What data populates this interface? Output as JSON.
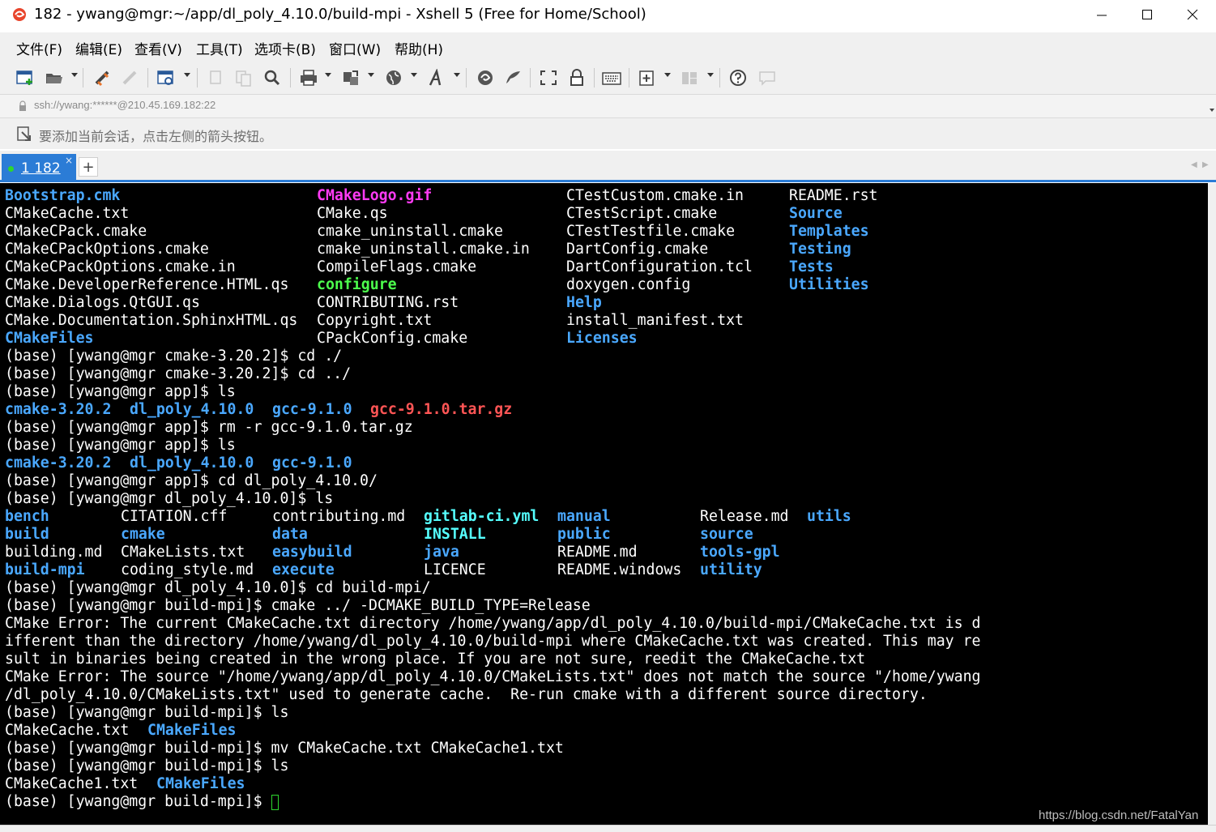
{
  "window": {
    "title": "182 - ywang@mgr:~/app/dl_poly_4.10.0/build-mpi - Xshell 5 (Free for Home/School)"
  },
  "menu": [
    "文件(F)",
    "编辑(E)",
    "查看(V)",
    "工具(T)",
    "选项卡(B)",
    "窗口(W)",
    "帮助(H)"
  ],
  "toolbar": {
    "icons": [
      "new-session-icon",
      "open-folder-icon",
      "reconnect-icon",
      "disconnect-icon",
      "properties-icon",
      "copy-icon",
      "paste-icon",
      "find-icon",
      "print-icon",
      "transfer-icon",
      "globe-icon",
      "font-icon",
      "xftp-icon",
      "xmanager-icon",
      "fullscreen-icon",
      "lock-icon",
      "keyboard-icon",
      "add-icon",
      "layout-icon",
      "help-icon",
      "chat-icon"
    ]
  },
  "address": {
    "text": "ssh://ywang:******@210.45.169.182:22"
  },
  "infobar": {
    "text": "要添加当前会话，点击左侧的箭头按钮。"
  },
  "tabs": [
    {
      "label": "1 182",
      "close": "×"
    }
  ],
  "tab_add": "+",
  "terminal": {
    "colors": {
      "dir": "#4aa8ff",
      "image": "#ff3bf5",
      "executable": "#4dff4d",
      "archive": "#ff5555",
      "link": "#55ffff",
      "cursor": "#2ed62e"
    },
    "lines": [
      [
        {
          "t": "Bootstrap.cmk",
          "s": "dir"
        },
        {
          "t": "CMakeLogo.gif",
          "s": "mag"
        },
        {
          "t": "CTestCustom.cmake.in",
          "s": "white"
        },
        {
          "t": "README.rst",
          "s": "white"
        }
      ],
      [
        {
          "t": "CMakeCache.txt",
          "s": "white"
        },
        {
          "t": "CMake.qs",
          "s": "white"
        },
        {
          "t": "CTestScript.cmake",
          "s": "white"
        },
        {
          "t": "Source",
          "s": "dir"
        }
      ],
      [
        {
          "t": "CMakeCPack.cmake",
          "s": "white"
        },
        {
          "t": "cmake_uninstall.cmake",
          "s": "white"
        },
        {
          "t": "CTestTestfile.cmake",
          "s": "white"
        },
        {
          "t": "Templates",
          "s": "dir"
        }
      ],
      [
        {
          "t": "CMakeCPackOptions.cmake",
          "s": "white"
        },
        {
          "t": "cmake_uninstall.cmake.in",
          "s": "white"
        },
        {
          "t": "DartConfig.cmake",
          "s": "white"
        },
        {
          "t": "Testing",
          "s": "dir"
        }
      ],
      [
        {
          "t": "CMakeCPackOptions.cmake.in",
          "s": "white"
        },
        {
          "t": "CompileFlags.cmake",
          "s": "white"
        },
        {
          "t": "DartConfiguration.tcl",
          "s": "white"
        },
        {
          "t": "Tests",
          "s": "dir"
        }
      ],
      [
        {
          "t": "CMake.DeveloperReference.HTML.qs",
          "s": "white"
        },
        {
          "t": "configure",
          "s": "exe"
        },
        {
          "t": "doxygen.config",
          "s": "white"
        },
        {
          "t": "Utilities",
          "s": "dir"
        }
      ],
      [
        {
          "t": "CMake.Dialogs.QtGUI.qs",
          "s": "white"
        },
        {
          "t": "CONTRIBUTING.rst",
          "s": "white"
        },
        {
          "t": "Help",
          "s": "dir"
        }
      ],
      [
        {
          "t": "CMake.Documentation.SphinxHTML.qs",
          "s": "white"
        },
        {
          "t": "Copyright.txt",
          "s": "white"
        },
        {
          "t": "install_manifest.txt",
          "s": "white"
        }
      ],
      [
        {
          "t": "CMakeFiles",
          "s": "dir"
        },
        {
          "t": "CPackConfig.cmake",
          "s": "white"
        },
        {
          "t": "Licenses",
          "s": "dir"
        }
      ],
      [
        {
          "t": "(base) [ywang@mgr cmake-3.20.2]$ cd ./",
          "s": "white"
        }
      ],
      [
        {
          "t": "(base) [ywang@mgr cmake-3.20.2]$ cd ../",
          "s": "white"
        }
      ],
      [
        {
          "t": "(base) [ywang@mgr app]$ ls",
          "s": "white"
        }
      ],
      [
        {
          "t": "cmake-3.20.2",
          "s": "dir"
        },
        {
          "t": "dl_poly_4.10.0",
          "s": "dir"
        },
        {
          "t": "gcc-9.1.0",
          "s": "dir"
        },
        {
          "t": "gcc-9.1.0.tar.gz",
          "s": "red"
        }
      ],
      [
        {
          "t": "(base) [ywang@mgr app]$ rm -r gcc-9.1.0.tar.gz",
          "s": "white"
        }
      ],
      [
        {
          "t": "(base) [ywang@mgr app]$ ls",
          "s": "white"
        }
      ],
      [
        {
          "t": "cmake-3.20.2",
          "s": "dir"
        },
        {
          "t": "dl_poly_4.10.0",
          "s": "dir"
        },
        {
          "t": "gcc-9.1.0",
          "s": "dir"
        }
      ],
      [
        {
          "t": "(base) [ywang@mgr app]$ cd dl_poly_4.10.0/",
          "s": "white"
        }
      ],
      [
        {
          "t": "(base) [ywang@mgr dl_poly_4.10.0]$ ls",
          "s": "white"
        }
      ],
      [
        {
          "t": "bench",
          "s": "dir"
        },
        {
          "t": "CITATION.cff",
          "s": "white"
        },
        {
          "t": "contributing.md",
          "s": "white"
        },
        {
          "t": "gitlab-ci.yml",
          "s": "cyan"
        },
        {
          "t": "manual",
          "s": "dir"
        },
        {
          "t": "Release.md",
          "s": "white"
        },
        {
          "t": "utils",
          "s": "dir"
        }
      ],
      [
        {
          "t": "build",
          "s": "dir"
        },
        {
          "t": "cmake",
          "s": "dir"
        },
        {
          "t": "data",
          "s": "dir"
        },
        {
          "t": "INSTALL",
          "s": "cyan"
        },
        {
          "t": "public",
          "s": "dir"
        },
        {
          "t": "source",
          "s": "dir"
        }
      ],
      [
        {
          "t": "building.md",
          "s": "white"
        },
        {
          "t": "CMakeLists.txt",
          "s": "white"
        },
        {
          "t": "easybuild",
          "s": "dir"
        },
        {
          "t": "java",
          "s": "dir"
        },
        {
          "t": "README.md",
          "s": "white"
        },
        {
          "t": "tools-gpl",
          "s": "dir"
        }
      ],
      [
        {
          "t": "build-mpi",
          "s": "dir"
        },
        {
          "t": "coding_style.md",
          "s": "white"
        },
        {
          "t": "execute",
          "s": "dir"
        },
        {
          "t": "LICENCE",
          "s": "white"
        },
        {
          "t": "README.windows",
          "s": "white"
        },
        {
          "t": "utility",
          "s": "dir"
        }
      ],
      [
        {
          "t": "(base) [ywang@mgr dl_poly_4.10.0]$ cd build-mpi/",
          "s": "white"
        }
      ],
      [
        {
          "t": "(base) [ywang@mgr build-mpi]$ cmake ../ -DCMAKE_BUILD_TYPE=Release",
          "s": "white"
        }
      ],
      [
        {
          "t": "CMake Error: The current CMakeCache.txt directory /home/ywang/app/dl_poly_4.10.0/build-mpi/CMakeCache.txt is d",
          "s": "white"
        }
      ],
      [
        {
          "t": "ifferent than the directory /home/ywang/dl_poly_4.10.0/build-mpi where CMakeCache.txt was created. This may re",
          "s": "white"
        }
      ],
      [
        {
          "t": "sult in binaries being created in the wrong place. If you are not sure, reedit the CMakeCache.txt",
          "s": "white"
        }
      ],
      [
        {
          "t": "CMake Error: The source \"/home/ywang/app/dl_poly_4.10.0/CMakeLists.txt\" does not match the source \"/home/ywang",
          "s": "white"
        }
      ],
      [
        {
          "t": "/dl_poly_4.10.0/CMakeLists.txt\" used to generate cache.  Re-run cmake with a different source directory.",
          "s": "white"
        }
      ],
      [
        {
          "t": "(base) [ywang@mgr build-mpi]$ ls",
          "s": "white"
        }
      ],
      [
        {
          "t": "CMakeCache.txt",
          "s": "white"
        },
        {
          "t": "CMakeFiles",
          "s": "dir"
        }
      ],
      [
        {
          "t": "(base) [ywang@mgr build-mpi]$ mv CMakeCache.txt CMakeCache1.txt",
          "s": "white"
        }
      ],
      [
        {
          "t": "(base) [ywang@mgr build-mpi]$ ls",
          "s": "white"
        }
      ],
      [
        {
          "t": "CMakeCache1.txt",
          "s": "white"
        },
        {
          "t": "CMakeFiles",
          "s": "dir"
        }
      ],
      [
        {
          "t": "(base) [ywang@mgr build-mpi]$ ",
          "s": "white",
          "cursor": true
        }
      ]
    ]
  },
  "watermark": "https://blog.csdn.net/FatalYan"
}
